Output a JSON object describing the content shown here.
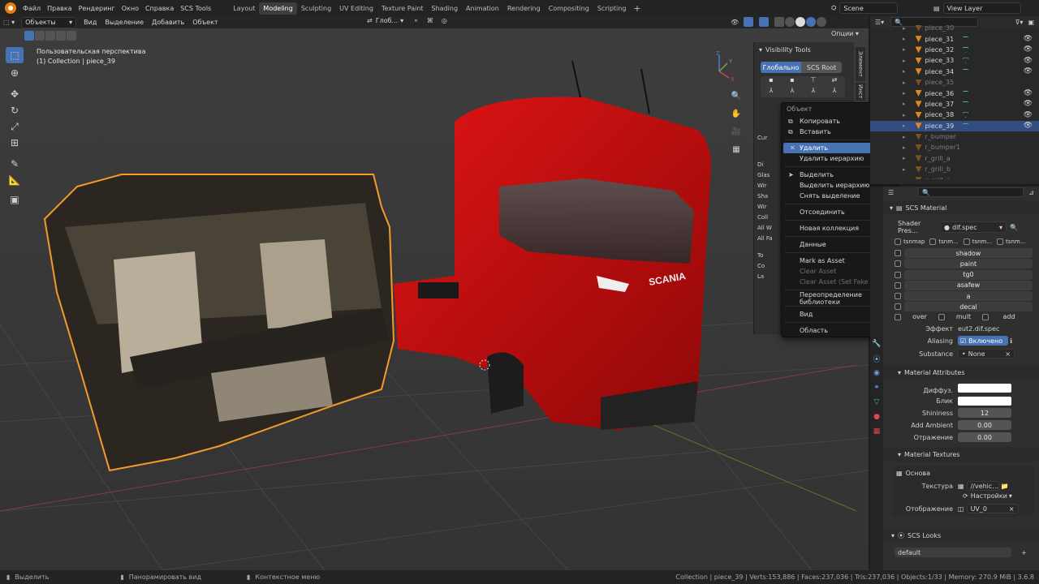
{
  "topbar": {
    "menus": [
      "Файл",
      "Правка",
      "Рендеринг",
      "Окно",
      "Справка",
      "SCS Tools"
    ],
    "workspaces": [
      "Layout",
      "Modeling",
      "Sculpting",
      "UV Editing",
      "Texture Paint",
      "Shading",
      "Animation",
      "Rendering",
      "Compositing",
      "Scripting"
    ],
    "active_workspace": "Modeling",
    "add_tab": "+",
    "scene": "Scene",
    "view_layer": "View Layer"
  },
  "viewport_header": {
    "mode": "Объекты",
    "menus": [
      "Вид",
      "Выделение",
      "Добавить",
      "Объект"
    ],
    "orientation": "Глоб...",
    "options": "Опции"
  },
  "viewport": {
    "view_name": "Пользовательская перспектива",
    "collection_info": "(1) Collection | piece_39",
    "axis_x": "X",
    "axis_y": "Y",
    "axis_z": "Z"
  },
  "npanel": {
    "title": "Visibility Tools",
    "btn_global": "Глобально",
    "btn_root": "SCS Root",
    "tabs": [
      "Элемент",
      "Инст"
    ],
    "rows": [
      "Cur",
      "Di",
      "Glas",
      "Wir",
      "Sha",
      "Wir",
      "Coll",
      "All W",
      "All Fa",
      "To",
      "Co",
      "La"
    ]
  },
  "context_menu": {
    "title": "Объект",
    "items": [
      {
        "icon": "copy",
        "label": "Копировать",
        "shortcut": "Ctrl C"
      },
      {
        "icon": "paste",
        "label": "Вставить",
        "shortcut": "Ctrl V"
      },
      {
        "sep": true
      },
      {
        "icon": "x",
        "label": "Удалить",
        "shortcut": "X",
        "selected": true
      },
      {
        "label": "Удалить иерархию"
      },
      {
        "sep": true
      },
      {
        "icon": "cursor",
        "label": "Выделить"
      },
      {
        "label": "Выделить иерархию"
      },
      {
        "label": "Снять выделение"
      },
      {
        "sep": true
      },
      {
        "label": "Отсоединить"
      },
      {
        "sep": true
      },
      {
        "label": "Новая коллекция"
      },
      {
        "sep": true
      },
      {
        "label": "Данные",
        "submenu": true
      },
      {
        "sep": true
      },
      {
        "label": "Mark as Asset"
      },
      {
        "label": "Clear Asset",
        "disabled": true
      },
      {
        "label": "Clear Asset (Set Fake User)",
        "disabled": true
      },
      {
        "sep": true
      },
      {
        "label": "Переопределение библиотеки",
        "submenu": true
      },
      {
        "sep": true
      },
      {
        "label": "Вид",
        "submenu": true
      },
      {
        "sep": true
      },
      {
        "label": "Область",
        "submenu": true
      }
    ]
  },
  "outliner": {
    "rows": [
      {
        "name": "piece_30",
        "dim": true
      },
      {
        "name": "piece_31"
      },
      {
        "name": "piece_32"
      },
      {
        "name": "piece_33"
      },
      {
        "name": "piece_34"
      },
      {
        "name": "piece_35",
        "dim": true
      },
      {
        "name": "piece_36"
      },
      {
        "name": "piece_37"
      },
      {
        "name": "piece_38"
      },
      {
        "name": "piece_39",
        "selected": true
      },
      {
        "name": "r_bumper",
        "dim": true
      },
      {
        "name": "r_bumper1",
        "dim": true
      },
      {
        "name": "r_grill_a",
        "dim": true
      },
      {
        "name": "r_grill_b",
        "dim": true
      },
      {
        "name": "r_grill_c",
        "dim": true
      }
    ]
  },
  "properties": {
    "section_material": "SCS Material",
    "shader_preset_label": "Shader Pres...",
    "shader_preset_value": "dif.spec",
    "flags": [
      "tsnmap",
      "tsnm...",
      "tsnm...",
      "tsnm..."
    ],
    "flag_rows": [
      "shadow",
      "paint",
      "tg0",
      "asafew",
      "a",
      "decal"
    ],
    "last_row": [
      "over",
      "mult",
      "add"
    ],
    "effect_label": "Эффект",
    "effect_value": "eut2.dif.spec",
    "aliasing_label": "Aliasing",
    "aliasing_value": "Включено",
    "substance_label": "Substance",
    "substance_value": "None",
    "section_attrs": "Material Attributes",
    "attrs": [
      {
        "label": "Диффуз.",
        "kind": "color"
      },
      {
        "label": "Блик",
        "kind": "color"
      },
      {
        "label": "Shininess",
        "value": "12"
      },
      {
        "label": "Add Ambient",
        "value": "0.00"
      },
      {
        "label": "Отражение",
        "value": "0.00"
      }
    ],
    "section_textures": "Material Textures",
    "texture_name": "Основа",
    "texture_label": "Текстура",
    "texture_value": "//vehic...",
    "texture_settings": "Настройки",
    "mapping_label": "Отображение",
    "mapping_value": "UV_0",
    "section_looks": "SCS Looks",
    "look_value": "default"
  },
  "statusbar": {
    "left": [
      {
        "label": "Выделить"
      },
      {
        "label": "Панорамировать вид"
      },
      {
        "label": "Контекстное меню"
      }
    ],
    "right": "Collection | piece_39 | Verts:153,886 | Faces:237,036 | Tris:237,036 | Objects:1/33 | Memory: 270.9 MiB | 3.6.8"
  }
}
